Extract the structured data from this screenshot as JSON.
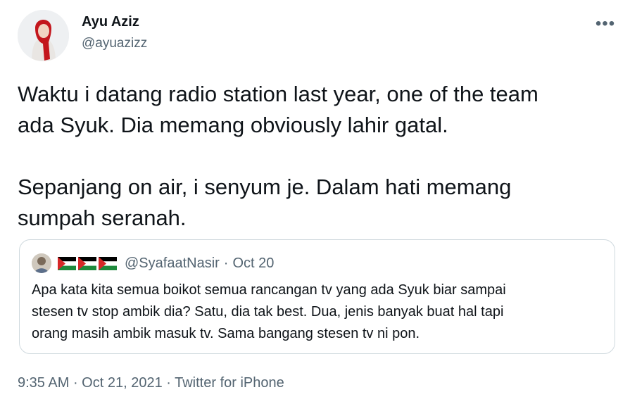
{
  "author": {
    "name": "Ayu Aziz",
    "handle": "@ayuazizz"
  },
  "tweet": {
    "text": "Waktu i datang radio station last year, one of the team\nada Syuk. Dia memang obviously lahir gatal.\n\nSepanjang on air, i senyum je. Dalam hati memang\nsumpah seranah."
  },
  "quoted": {
    "handle": "@SyafaatNasir",
    "separator": "·",
    "date": "Oct 20",
    "flags_icon": "palestine-flag-icon",
    "text": "Apa kata kita semua boikot semua rancangan tv yang ada Syuk biar sampai\nstesen tv stop ambik dia? Satu, dia tak best. Dua, jenis banyak buat hal tapi\norang masih ambik masuk tv. Sama bangang stesen tv ni pon."
  },
  "meta": {
    "time": "9:35 AM",
    "sep1": " · ",
    "date": "Oct 21, 2021",
    "sep2": " · ",
    "source": "Twitter for iPhone"
  },
  "more_icon": "more-options-icon",
  "colors": {
    "primary_text": "#0f1419",
    "secondary_text": "#536471",
    "border": "#cfd9de"
  }
}
